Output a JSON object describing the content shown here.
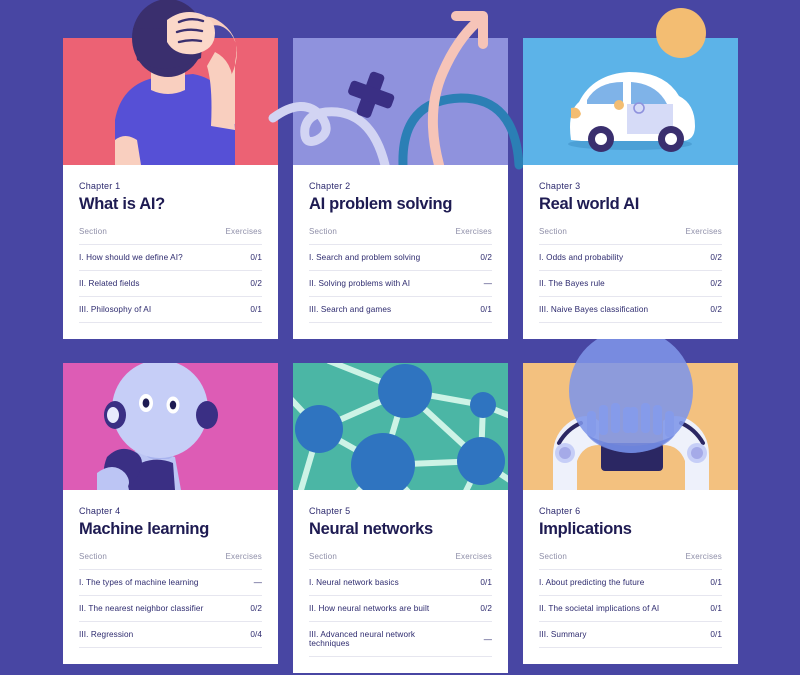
{
  "page": {
    "background_color": "#4846a3",
    "card_background": "#ffffff"
  },
  "table_headers": {
    "section": "Section",
    "exercises": "Exercises"
  },
  "cards": [
    {
      "chapter": "Chapter 1",
      "title": "What is AI?",
      "illustration": "person-scratching-head-illustration",
      "bg_color": "#ec6274",
      "sections": [
        {
          "name": "I. How should we define AI?",
          "exercises": "0/1"
        },
        {
          "name": "II. Related fields",
          "exercises": "0/2"
        },
        {
          "name": "III. Philosophy of AI",
          "exercises": "0/1"
        }
      ]
    },
    {
      "chapter": "Chapter 2",
      "title": "AI problem solving",
      "illustration": "paths-arrow-cross-illustration",
      "bg_color": "#8f92dd",
      "sections": [
        {
          "name": "I. Search and problem solving",
          "exercises": "0/2"
        },
        {
          "name": "II. Solving problems with AI",
          "exercises": "—"
        },
        {
          "name": "III. Search and games",
          "exercises": "0/1"
        }
      ]
    },
    {
      "chapter": "Chapter 3",
      "title": "Real world AI",
      "illustration": "self-driving-car-illustration",
      "bg_color": "#5cb3e8",
      "sections": [
        {
          "name": "I. Odds and probability",
          "exercises": "0/2"
        },
        {
          "name": "II. The Bayes rule",
          "exercises": "0/2"
        },
        {
          "name": "III. Naive Bayes classification",
          "exercises": "0/2"
        }
      ]
    },
    {
      "chapter": "Chapter 4",
      "title": "Machine learning",
      "illustration": "robot-portrait-illustration",
      "bg_color": "#dd5cb5",
      "sections": [
        {
          "name": "I. The types of machine learning",
          "exercises": "—"
        },
        {
          "name": "II. The nearest neighbor classifier",
          "exercises": "0/2"
        },
        {
          "name": "III. Regression",
          "exercises": "0/4"
        }
      ]
    },
    {
      "chapter": "Chapter 5",
      "title": "Neural networks",
      "illustration": "network-nodes-illustration",
      "bg_color": "#4bb6a5",
      "sections": [
        {
          "name": "I. Neural network basics",
          "exercises": "0/1"
        },
        {
          "name": "II. How neural networks are built",
          "exercises": "0/2"
        },
        {
          "name": "III. Advanced neural network techniques",
          "exercises": "—"
        }
      ]
    },
    {
      "chapter": "Chapter 6",
      "title": "Implications",
      "illustration": "robot-hands-crystal-ball-illustration",
      "bg_color": "#f3c17f",
      "sections": [
        {
          "name": "I. About predicting the future",
          "exercises": "0/1"
        },
        {
          "name": "II. The societal implications of AI",
          "exercises": "0/1"
        },
        {
          "name": "III. Summary",
          "exercises": "0/1"
        }
      ]
    }
  ]
}
